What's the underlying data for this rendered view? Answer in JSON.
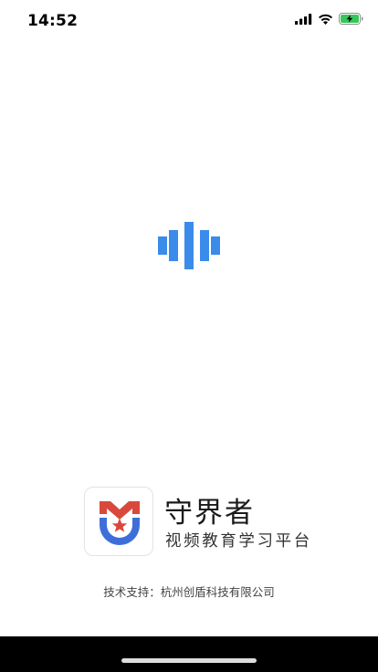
{
  "status_bar": {
    "time": "14:52",
    "icons": [
      "cellular-signal-icon",
      "wifi-icon",
      "battery-charging-icon"
    ],
    "battery_color": "#34c759"
  },
  "loader": {
    "icon": "audio-wave-loading-icon",
    "color": "#3b8beb"
  },
  "brand": {
    "logo": "shield-star-logo",
    "name": "守界者",
    "tagline": "视频教育学习平台",
    "colors": {
      "red": "#d8493c",
      "blue": "#3e6fd9"
    }
  },
  "footer": {
    "support_text": "技术支持：杭州创盾科技有限公司"
  },
  "home_indicator": {
    "bar_color": "#000000"
  }
}
